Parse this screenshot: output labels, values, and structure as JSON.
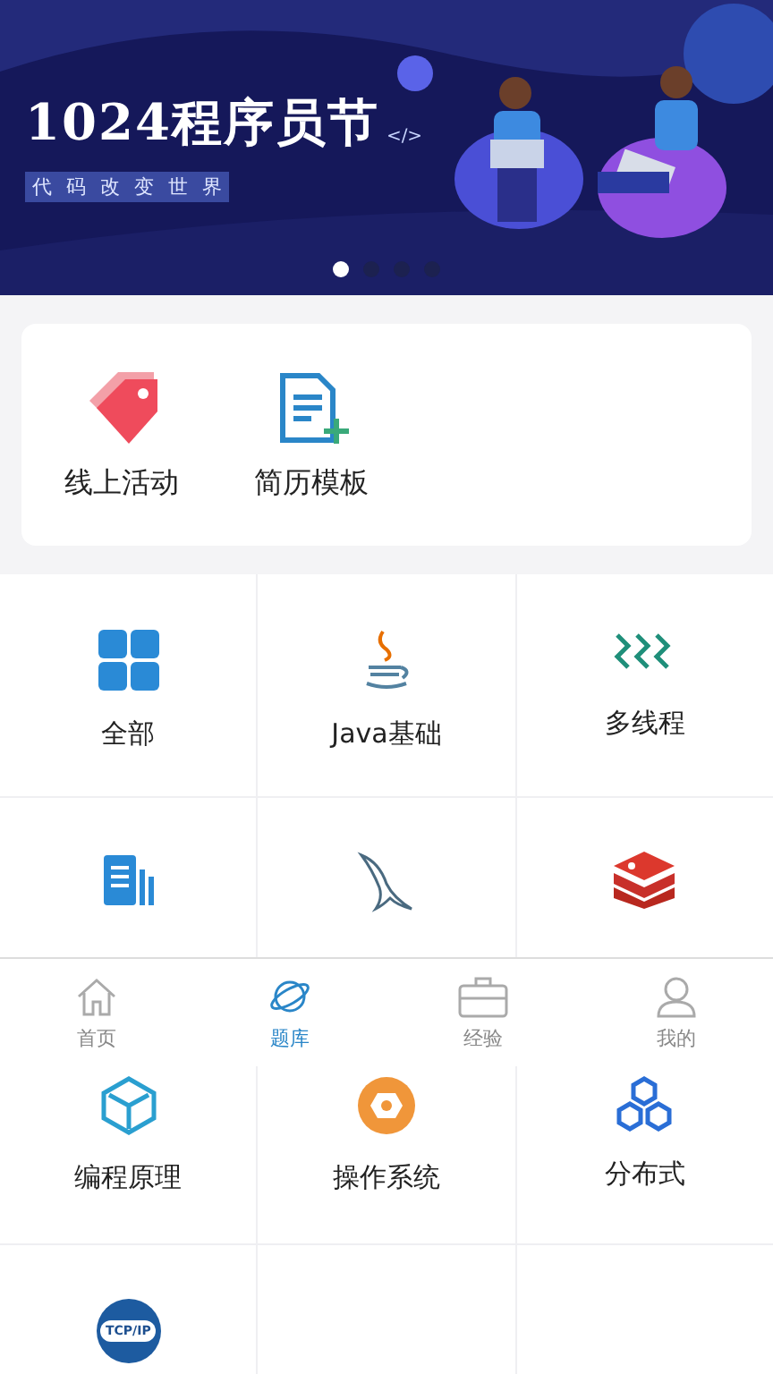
{
  "banner": {
    "title": "1024程序员节",
    "tag": "</>",
    "subtitle": [
      "代",
      "码",
      "改",
      "变",
      "世",
      "界"
    ],
    "dots": [
      {
        "selected": true
      },
      {
        "selected": false
      },
      {
        "selected": false
      },
      {
        "selected": false
      }
    ]
  },
  "shortcuts": [
    {
      "label": "线上活动"
    },
    {
      "label": "简历模板"
    }
  ],
  "categories": [
    {
      "kind": "labeled",
      "label": "全部"
    },
    {
      "kind": "labeled",
      "label": "Java基础"
    },
    {
      "kind": "labeled",
      "label": "多线程"
    },
    {
      "kind": "icon_only"
    },
    {
      "kind": "icon_only"
    },
    {
      "kind": "icon_only"
    },
    {
      "kind": "labeled",
      "label": "编程原理"
    },
    {
      "kind": "labeled",
      "label": "操作系统"
    },
    {
      "kind": "labeled",
      "label": "分布式"
    },
    {
      "kind": "badge",
      "icon_text": "TCP/IP"
    }
  ],
  "tab_bar": [
    {
      "label": "首页",
      "selected": false
    },
    {
      "label": "题库",
      "selected": true
    },
    {
      "label": "经验",
      "selected": false
    },
    {
      "label": "我的",
      "selected": false
    }
  ]
}
